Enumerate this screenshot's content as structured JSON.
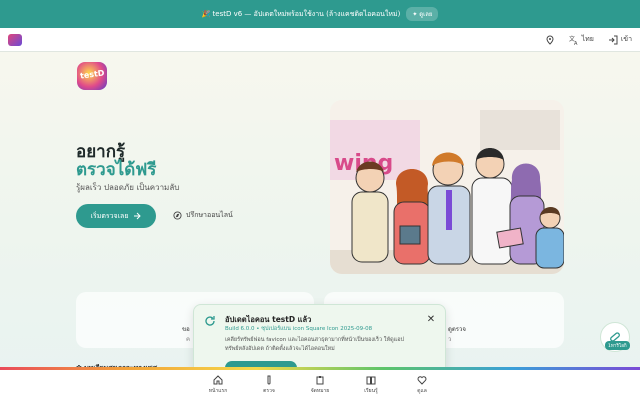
{
  "banner": {
    "text": "🎉 testD v6 — อัปเดตใหม่พร้อมใช้งาน (ล้างแคชติดไอคอนใหม่)",
    "button": "✦ ดูเลย"
  },
  "header": {
    "language": "ไทย",
    "login": "เข้า"
  },
  "hero": {
    "logo_text": "testD",
    "title_line1": "อยากรู้",
    "title_line2": "ตรวจได้ฟรี",
    "subtitle": "รู้ผลเร็ว ปลอดภัย เป็นความลับ",
    "cta": "เริ่มตรวจเลย",
    "consult": "ปรึกษาออนไลน์",
    "wall_sign": "wing"
  },
  "cards": [
    {
      "title": "ขอ",
      "desc": "ค"
    },
    {
      "title": "ดูตรวจ",
      "desc": "ว"
    }
  ],
  "section_title": "✿ บทเรียนสุขภาวะทางเพศ",
  "update": {
    "title": "อัปเดตไอคอน testD แล้ว",
    "meta": "Build 6.0.0  •  ซุปเปอร์แบน icon Square Icon  2025-09-08",
    "body": "เคลียร์ทรัพย์ฟอน favicon และไอคอนสาธุตามากที่หน้าเป็นของเร็ว ให้ดูแอปทรัพย์หลังอัปเดต ถ้าติดตั้งแล้วจะได้ไอคอนใหม่"
  },
  "fab": {
    "badge": "1ทาริโอกิ"
  },
  "nav": [
    {
      "label": "หน้าแรก",
      "icon": "home-icon"
    },
    {
      "label": "ตรวจ",
      "icon": "test-tube-icon"
    },
    {
      "label": "จัดหมาย",
      "icon": "clipboard-icon"
    },
    {
      "label": "เรียนรู้",
      "icon": "book-icon"
    },
    {
      "label": "ดูแล",
      "icon": "heart-icon"
    }
  ],
  "colors": {
    "accent": "#2e9a8f",
    "banner": "#2e9a8f"
  }
}
